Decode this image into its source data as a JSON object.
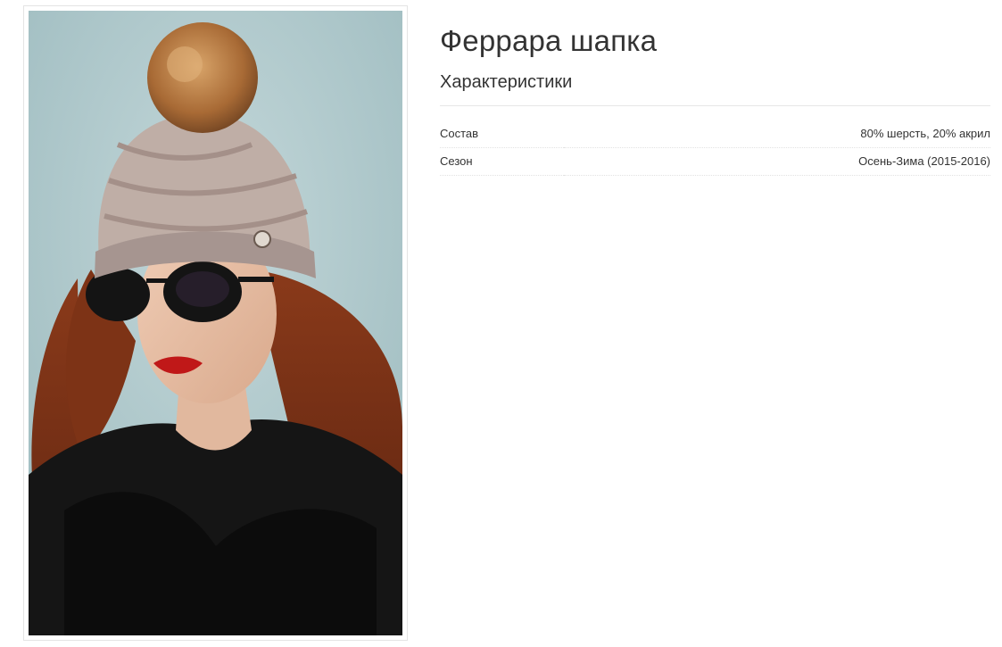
{
  "product": {
    "title": "Феррара шапка",
    "image_alt": "Феррара шапка"
  },
  "specs": {
    "heading": "Характеристики",
    "rows": [
      {
        "name": "Состав",
        "value": "80% шерсть, 20% акрил"
      },
      {
        "name": "Сезон",
        "value": "Осень-Зима (2015-2016)"
      }
    ]
  }
}
